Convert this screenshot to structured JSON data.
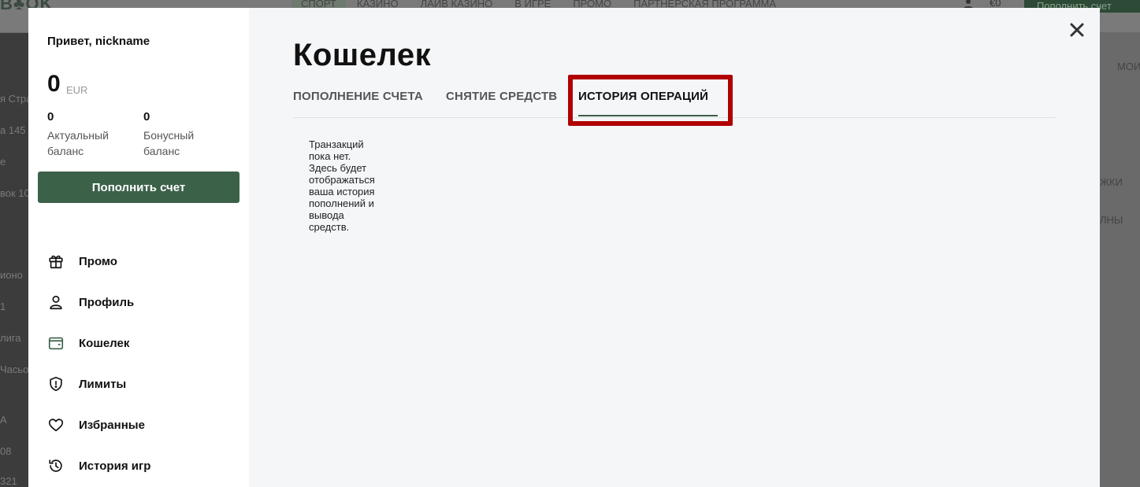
{
  "background": {
    "logo": "B♣OK",
    "nav": [
      "СПОРТ",
      "КАЗИНО",
      "ЛАЙВ КАЗИНО",
      "В ИГРЕ",
      "ПРОМО",
      "ПАРТНЕРСКАЯ ПРОГРАММА"
    ],
    "balance": "€0",
    "deposit_label": "Пополнить счет",
    "left_fragments": [
      "я Стра",
      "а 145",
      "е",
      "вок 10",
      "ионо",
      "1",
      "лига",
      "Часьо",
      "А",
      "08",
      "321"
    ],
    "right_fragments": [
      "МОИ",
      "ЖКИ",
      "ЛНЫ"
    ]
  },
  "sidebar": {
    "greeting": "Привет, nickname",
    "balance": "0",
    "currency": "EUR",
    "actual_balance_value": "0",
    "actual_balance_label": "Актуальный баланс",
    "bonus_balance_value": "0",
    "bonus_balance_label": "Бонусный баланс",
    "deposit_button": "Пополнить счет",
    "menu": [
      {
        "label": "Промо",
        "icon": "gift-icon"
      },
      {
        "label": "Профиль",
        "icon": "user-icon"
      },
      {
        "label": "Кошелек",
        "icon": "wallet-icon"
      },
      {
        "label": "Лимиты",
        "icon": "shield-icon"
      },
      {
        "label": "Избранные",
        "icon": "heart-icon"
      },
      {
        "label": "История игр",
        "icon": "history-icon"
      }
    ]
  },
  "main": {
    "title": "Кошелек",
    "tabs": [
      {
        "label": "ПОПОЛНЕНИЕ СЧЕТА",
        "active": false
      },
      {
        "label": "СНЯТИЕ СРЕДСТВ",
        "active": false
      },
      {
        "label": "ИСТОРИЯ ОПЕРАЦИЙ",
        "active": true
      }
    ],
    "empty_message": "Транзакций пока нет. Здесь будет отображаться ваша история пополнений и вывода средств."
  },
  "colors": {
    "accent": "#3c6149",
    "highlight": "#b00000",
    "overlay": "#5e5e5e"
  }
}
